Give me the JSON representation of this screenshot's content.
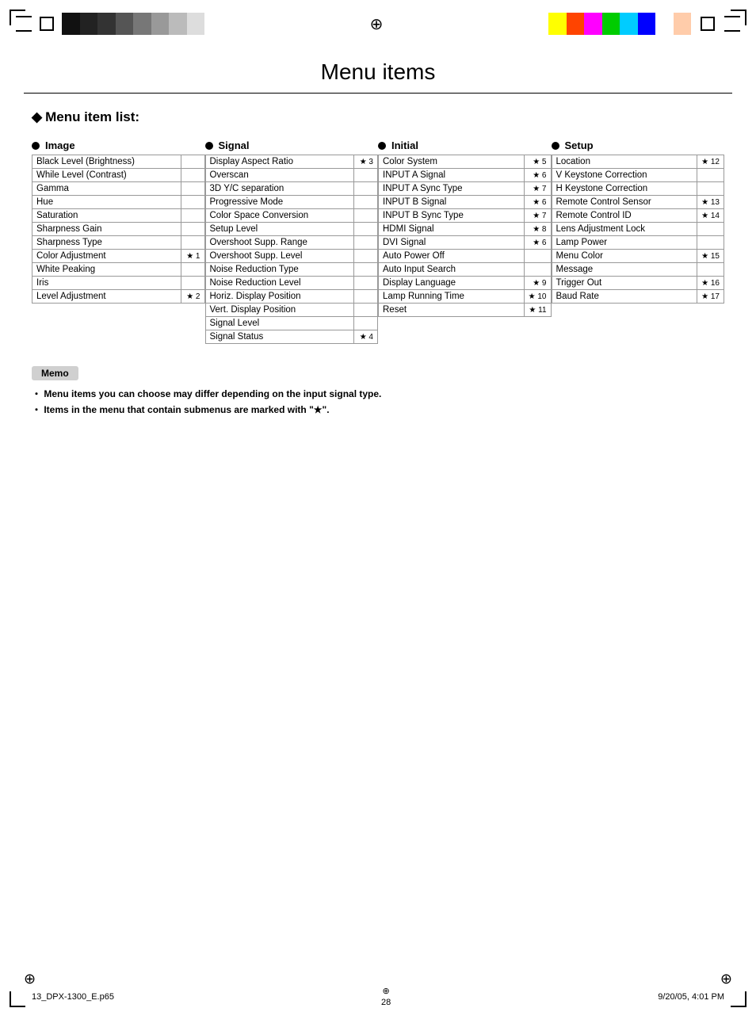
{
  "page": {
    "title": "Menu items",
    "section_heading": "Menu item list:",
    "page_number": "28",
    "footer_left": "13_DPX-1300_E.p65",
    "footer_center_page": "28",
    "footer_date": "9/20/05, 4:01 PM"
  },
  "columns": [
    {
      "id": "image",
      "header": "Image",
      "items": [
        {
          "label": "Black Level (Brightness)",
          "star": ""
        },
        {
          "label": "While Level (Contrast)",
          "star": ""
        },
        {
          "label": "Gamma",
          "star": ""
        },
        {
          "label": "Hue",
          "star": ""
        },
        {
          "label": "Saturation",
          "star": ""
        },
        {
          "label": "Sharpness Gain",
          "star": ""
        },
        {
          "label": "Sharpness Type",
          "star": ""
        },
        {
          "label": "Color Adjustment",
          "star": "★ 1"
        },
        {
          "label": "White Peaking",
          "star": ""
        },
        {
          "label": "Iris",
          "star": ""
        },
        {
          "label": "Level Adjustment",
          "star": "★ 2"
        }
      ]
    },
    {
      "id": "signal",
      "header": "Signal",
      "items": [
        {
          "label": "Display Aspect Ratio",
          "star": "★ 3"
        },
        {
          "label": "Overscan",
          "star": ""
        },
        {
          "label": "3D Y/C separation",
          "star": ""
        },
        {
          "label": "Progressive Mode",
          "star": ""
        },
        {
          "label": "Color Space Conversion",
          "star": ""
        },
        {
          "label": "Setup Level",
          "star": ""
        },
        {
          "label": "Overshoot Supp. Range",
          "star": ""
        },
        {
          "label": "Overshoot Supp. Level",
          "star": ""
        },
        {
          "label": "Noise Reduction Type",
          "star": ""
        },
        {
          "label": "Noise Reduction Level",
          "star": ""
        },
        {
          "label": "Horiz. Display Position",
          "star": ""
        },
        {
          "label": "Vert. Display Position",
          "star": ""
        },
        {
          "label": "Signal Level",
          "star": ""
        },
        {
          "label": "Signal Status",
          "star": "★ 4"
        }
      ]
    },
    {
      "id": "initial",
      "header": "Initial",
      "items": [
        {
          "label": "Color System",
          "star": "★ 5"
        },
        {
          "label": "INPUT A Signal",
          "star": "★ 6"
        },
        {
          "label": "INPUT A Sync Type",
          "star": "★ 7"
        },
        {
          "label": "INPUT B Signal",
          "star": "★ 6"
        },
        {
          "label": "INPUT B Sync Type",
          "star": "★ 7"
        },
        {
          "label": "HDMI Signal",
          "star": "★ 8"
        },
        {
          "label": "DVI Signal",
          "star": "★ 6"
        },
        {
          "label": "Auto Power Off",
          "star": ""
        },
        {
          "label": "Auto Input Search",
          "star": ""
        },
        {
          "label": "Display Language",
          "star": "★ 9"
        },
        {
          "label": "Lamp Running Time",
          "star": "★ 10"
        },
        {
          "label": "Reset",
          "star": "★ 11"
        }
      ]
    },
    {
      "id": "setup",
      "header": "Setup",
      "items": [
        {
          "label": "Location",
          "star": "★ 12"
        },
        {
          "label": "V Keystone Correction",
          "star": ""
        },
        {
          "label": "H Keystone Correction",
          "star": ""
        },
        {
          "label": "Remote Control Sensor",
          "star": "★ 13"
        },
        {
          "label": "Remote Control ID",
          "star": "★ 14"
        },
        {
          "label": "Lens Adjustment Lock",
          "star": ""
        },
        {
          "label": "Lamp Power",
          "star": ""
        },
        {
          "label": "Menu Color",
          "star": "★ 15"
        },
        {
          "label": "Message",
          "star": ""
        },
        {
          "label": "Trigger Out",
          "star": "★ 16"
        },
        {
          "label": "Baud Rate",
          "star": "★ 17"
        }
      ]
    }
  ],
  "memo": {
    "label": "Memo",
    "lines": [
      "・ Menu items you can choose may differ depending on the input signal type.",
      "・ Items in the menu that contain submenus are marked with \"★\"."
    ]
  },
  "color_bars": [
    "#000000",
    "#ffffff",
    "#ff0",
    "#00ffff",
    "#ff00ff",
    "#00ff00",
    "#0000ff",
    "#ff0000"
  ],
  "color_bars_right": [
    "#ffff00",
    "#ff0000",
    "#ff00ff",
    "#00ff00",
    "#00ffff",
    "#0000ff",
    "#ffffff",
    "#cccccc"
  ]
}
